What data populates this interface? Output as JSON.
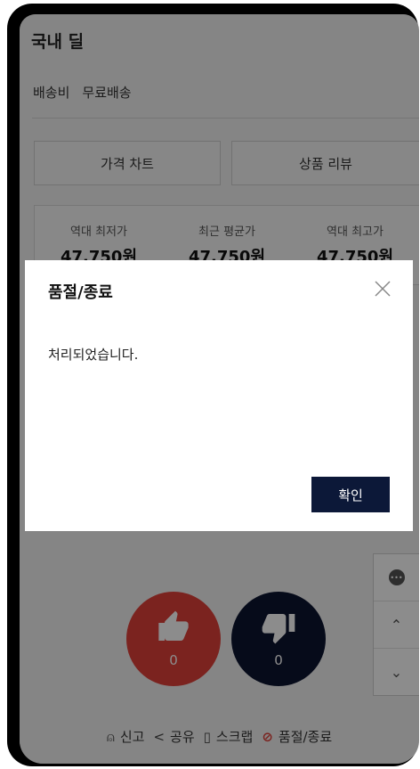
{
  "deal": {
    "title": "국내 딜",
    "shipping_label": "배송비",
    "shipping_value": "무료배송"
  },
  "tabs": {
    "chart_label": "가격 차트",
    "review_label": "상품 리뷰"
  },
  "prices": [
    {
      "label": "역대 최저가",
      "value": "47,750원"
    },
    {
      "label": "최근 평균가",
      "value": "47,750원"
    },
    {
      "label": "역대 최고가",
      "value": "47,750원"
    }
  ],
  "votes": {
    "up_count": "0",
    "down_count": "0"
  },
  "side_controls": {
    "chat_icon": "chat-bubble-icon",
    "up_icon": "chevron-up-icon",
    "down_icon": "chevron-down-icon"
  },
  "footer": {
    "report_label": "신고",
    "share_label": "공유",
    "scrap_label": "스크랩",
    "soldout_label": "품절/종료"
  },
  "modal": {
    "title": "품절/종료",
    "message": "처리되었습니다.",
    "confirm_label": "확인"
  },
  "colors": {
    "accent_navy": "#0c1838",
    "vote_up": "#e0403a",
    "vote_down": "#0c1430"
  }
}
